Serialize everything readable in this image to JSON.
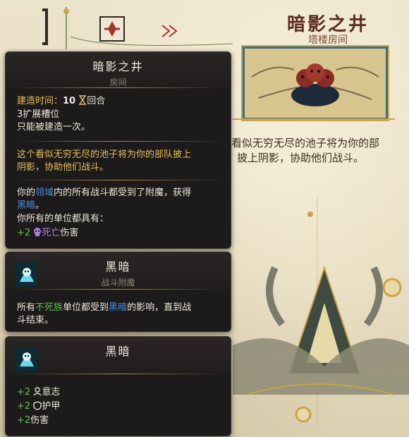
{
  "page": {
    "title": "暗影之井",
    "subtitle": "塔楼房间",
    "description_lines": [
      "看似无穷无尽的池子将为你的部",
      "披上阴影，协助他们战斗。"
    ]
  },
  "room_tooltip": {
    "title": "暗影之井",
    "subtitle": "房间",
    "build_time_label": "建造时间：",
    "build_time_value": "10",
    "build_time_unit": "回合",
    "slots": "3扩展槽位",
    "unique": "只能被建造一次。",
    "desc_line1": "这个看似无穷无尽的池子将为你的部队披上",
    "desc_line2": "阴影，协助他们战斗。",
    "effect_part1": "你的",
    "effect_link1": "领域",
    "effect_part2": "内的所有战斗都受到了附魔，获得",
    "effect_link2": "黑暗",
    "effect_part3": "。",
    "units_label": "你所有的单位都具有：",
    "bonus_value": "+2",
    "bonus_type": "死亡",
    "bonus_suffix": "伤害"
  },
  "enchant_tooltip": {
    "title": "黑暗",
    "subtitle": "战斗附魔",
    "text_part1": "所有",
    "text_link1": "不死族",
    "text_part2": "单位都受到",
    "text_link2": "黑暗",
    "text_part3": "的影响，直到战",
    "text_line2": "斗结束。"
  },
  "status_tooltip": {
    "title": "黑暗",
    "bonuses": [
      {
        "value": "+2",
        "icon": "resolve-icon",
        "label": "意志"
      },
      {
        "value": "+2",
        "icon": "shield-icon",
        "label": "护甲"
      },
      {
        "value": "+2",
        "icon": "",
        "label": "伤害"
      }
    ]
  },
  "colors": {
    "gold": "#e8c05a",
    "link_blue": "#4d8fe0",
    "bonus_green": "#5ec053",
    "death_purple": "#b27de0"
  }
}
